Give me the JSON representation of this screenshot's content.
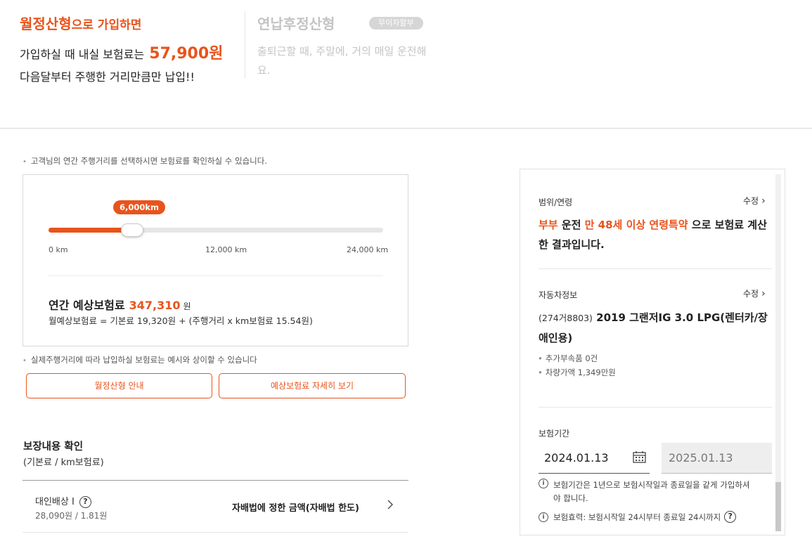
{
  "plans": {
    "left": {
      "title_highlight": "월정산형",
      "title_rest": "으로 가입하면",
      "line1_prefix": "가입하실 때 내실 보험료는",
      "line1_amount": "57,900원",
      "line2": "다음달부터 주행한 거리만큼만 납입!!"
    },
    "right": {
      "title": "연납후정산형",
      "badge": "무이자할부",
      "desc": "출퇴근할 때, 주말에, 거의 매일 운전해요."
    }
  },
  "notes": {
    "select_distance": "고객님의 연간 주행거리를 선택하시면 보험료를 확인하실 수 있습니다.",
    "actual_distance": "실제주행거리에 따라 납입하실 보험료는 예시와 상이할 수 있습니다"
  },
  "slider": {
    "value_label": "6,000km",
    "value_km": 6000,
    "max_km": 24000,
    "ticks": [
      "0 km",
      "12,000 km",
      "24,000 km"
    ]
  },
  "premium": {
    "annual_label": "연간 예상보험료",
    "annual_value": "347,310",
    "annual_unit": "원",
    "monthly_formula": "월예상보험료 = 기본료 19,320원 + (주행거리 x km보험료 15.54원)"
  },
  "buttons": {
    "guide": "월정산형 안내",
    "detail": "예상보험료 자세히 보기"
  },
  "coverage": {
    "title": "보장내용 확인",
    "subtitle": "(기본료 / km보험료)",
    "items": [
      {
        "name": "대인배상 I",
        "help": "?",
        "amount": "28,090원 / 1.81원",
        "limit": "자배법에 정한 금액(자배법 한도)"
      }
    ]
  },
  "panel": {
    "edit_label": "수정",
    "scope": {
      "label": "범위/연령",
      "driver": "부부",
      "t1": " 운전 ",
      "age": "만 48세 이상 연령특약",
      "t2": " 으로 보험료 계산한 결과입니다."
    },
    "car": {
      "label": "자동차정보",
      "plate": "(274거8803)",
      "model": " 2019 그랜저IG 3.0 LPG(렌터카/장애인용)",
      "extras": [
        "추가부속품 0건",
        "차량가액 1,349만원"
      ]
    },
    "period": {
      "label": "보험기간",
      "start": "2024.01.13",
      "end": "2025.01.13",
      "info1": "보험기간은 1년으로 보험시작일과 종료일을 같게 가입하셔야 합니다.",
      "info2": "보험효력: 보험시작일 24시부터 종료일 24시까지"
    }
  },
  "colors": {
    "accent": "#e8541c"
  },
  "icons": {
    "calendar": "calendar-icon",
    "help": "help-icon",
    "info": "info-icon",
    "chevron": "chevron-right-icon"
  }
}
